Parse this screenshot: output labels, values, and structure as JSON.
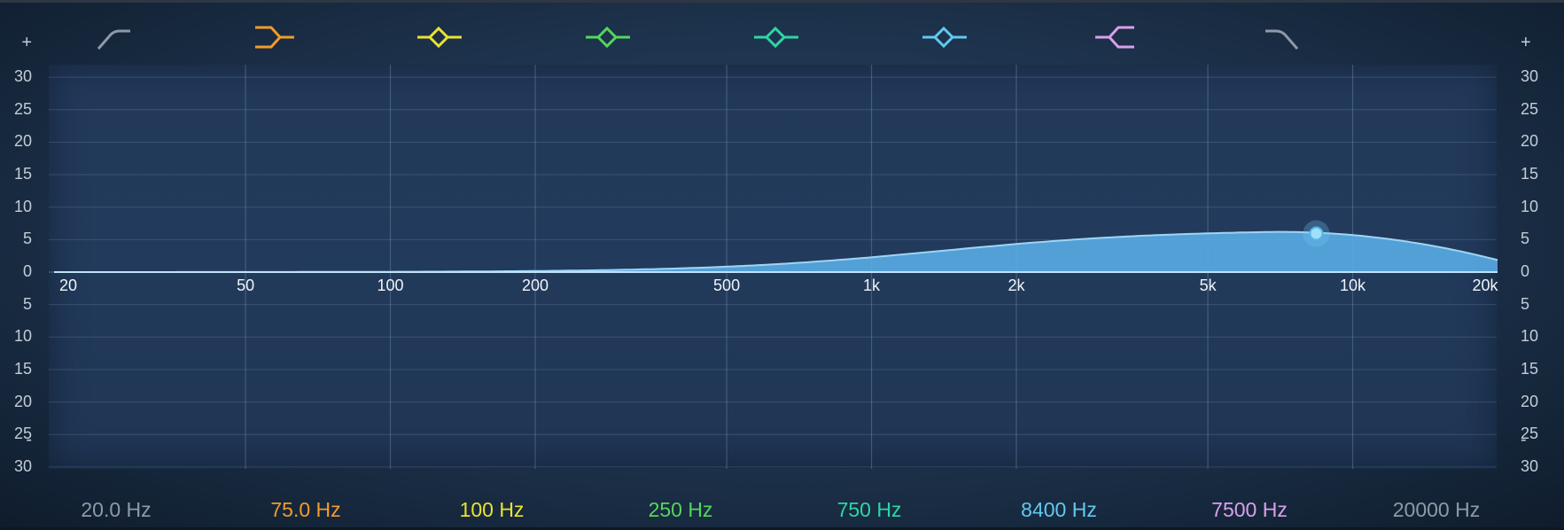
{
  "eq": {
    "scale": {
      "plus": "+",
      "minus": "-",
      "labels": [
        "30",
        "25",
        "20",
        "15",
        "10",
        "5",
        "0",
        "5",
        "10",
        "15",
        "20",
        "25",
        "30"
      ]
    },
    "freq_ticks": [
      {
        "label": "20",
        "hz": 20
      },
      {
        "label": "50",
        "hz": 50
      },
      {
        "label": "100",
        "hz": 100
      },
      {
        "label": "200",
        "hz": 200
      },
      {
        "label": "500",
        "hz": 500
      },
      {
        "label": "1k",
        "hz": 1000
      },
      {
        "label": "2k",
        "hz": 2000
      },
      {
        "label": "5k",
        "hz": 5000
      },
      {
        "label": "10k",
        "hz": 10000
      },
      {
        "label": "20k",
        "hz": 20000
      }
    ],
    "bands": [
      {
        "icon": "low-cut-icon",
        "freq_label": "20.0 Hz",
        "color": "#8e9aa8"
      },
      {
        "icon": "low-shelf-icon",
        "freq_label": "75.0 Hz",
        "color": "#f39b2a"
      },
      {
        "icon": "peak-icon",
        "freq_label": "100 Hz",
        "color": "#e9e42e"
      },
      {
        "icon": "peak-icon",
        "freq_label": "250 Hz",
        "color": "#55d65a"
      },
      {
        "icon": "peak-icon",
        "freq_label": "750 Hz",
        "color": "#2ed6a4"
      },
      {
        "icon": "peak-icon",
        "freq_label": "8400 Hz",
        "color": "#62c8ee"
      },
      {
        "icon": "high-shelf-icon",
        "freq_label": "7500 Hz",
        "color": "#d8a0ec"
      },
      {
        "icon": "high-cut-icon",
        "freq_label": "20000 Hz",
        "color": "#8e9aa8"
      }
    ],
    "active_band": {
      "freq_hz": 8400,
      "gain_db": 6.5
    },
    "curve_color": "#5aaee8"
  }
}
